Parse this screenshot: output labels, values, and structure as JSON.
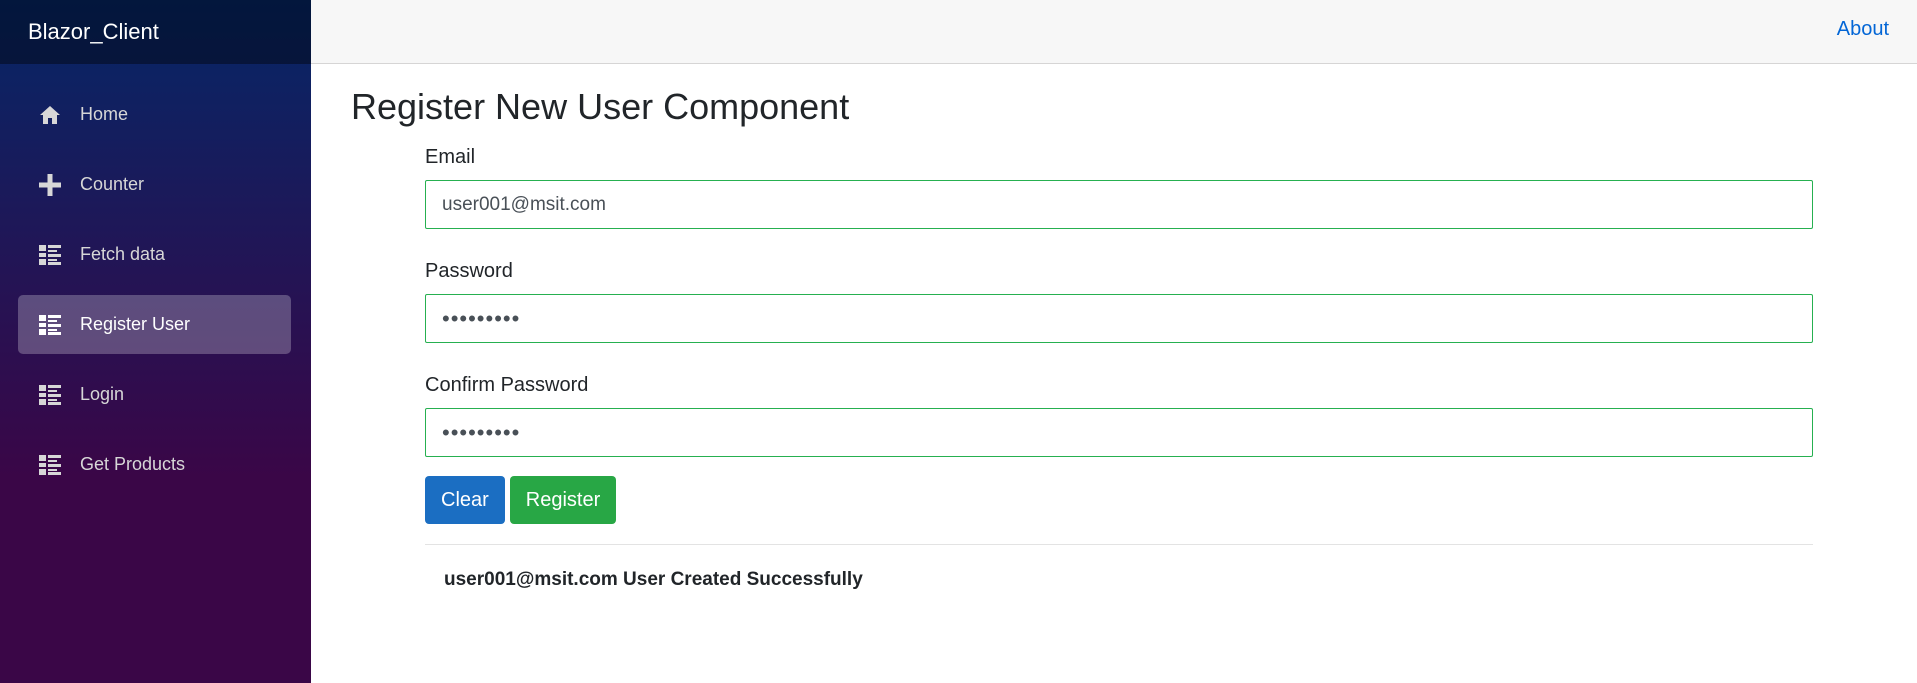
{
  "app": {
    "brand": "Blazor_Client"
  },
  "sidebar": {
    "items": [
      {
        "label": "Home",
        "icon": "home-icon",
        "active": false
      },
      {
        "label": "Counter",
        "icon": "plus-icon",
        "active": false
      },
      {
        "label": "Fetch data",
        "icon": "list-icon",
        "active": false
      },
      {
        "label": "Register User",
        "icon": "list-icon",
        "active": true
      },
      {
        "label": "Login",
        "icon": "list-icon",
        "active": false
      },
      {
        "label": "Get Products",
        "icon": "list-icon",
        "active": false
      }
    ]
  },
  "topbar": {
    "about_label": "About"
  },
  "page": {
    "title": "Register New User Component",
    "form": {
      "email_label": "Email",
      "email_value": "user001@msit.com",
      "password_label": "Password",
      "password_value": "•••••••••",
      "confirm_label": "Confirm Password",
      "confirm_value": "•••••••••",
      "clear_label": "Clear",
      "register_label": "Register"
    },
    "message": "user001@msit.com User Created Successfully"
  },
  "colors": {
    "sidebar_top": "#052767",
    "sidebar_bottom": "#3a0647",
    "input_border": "#26b050",
    "clear_button": "#1b6ec2",
    "register_button": "#28a745",
    "link": "#0366d6"
  }
}
